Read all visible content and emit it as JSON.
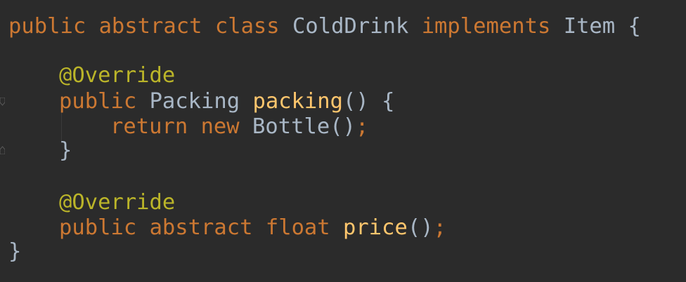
{
  "editor": {
    "lines": [
      {
        "tokens": [
          "public",
          "abstract",
          "class",
          "ColdDrink",
          "implements",
          "Item",
          "{"
        ]
      },
      {
        "tokens": []
      },
      {
        "tokens": [
          "@Override"
        ]
      },
      {
        "tokens": [
          "public",
          "Packing",
          "packing",
          "()",
          "{"
        ]
      },
      {
        "tokens": [
          "return",
          "new",
          "Bottle",
          "()",
          ";"
        ]
      },
      {
        "tokens": [
          "}"
        ]
      },
      {
        "tokens": []
      },
      {
        "tokens": [
          "@Override"
        ]
      },
      {
        "tokens": [
          "public",
          "abstract",
          "float",
          "price",
          "()",
          ";"
        ]
      },
      {
        "tokens": [
          "}"
        ]
      }
    ]
  },
  "icons": {
    "fold_start": "fold-start-icon",
    "fold_end": "fold-end-icon"
  },
  "colors": {
    "background": "#2b2b2b",
    "keyword": "#cc7832",
    "annotation": "#bbb529",
    "method": "#ffc66d",
    "identifier": "#a9b7c6"
  }
}
